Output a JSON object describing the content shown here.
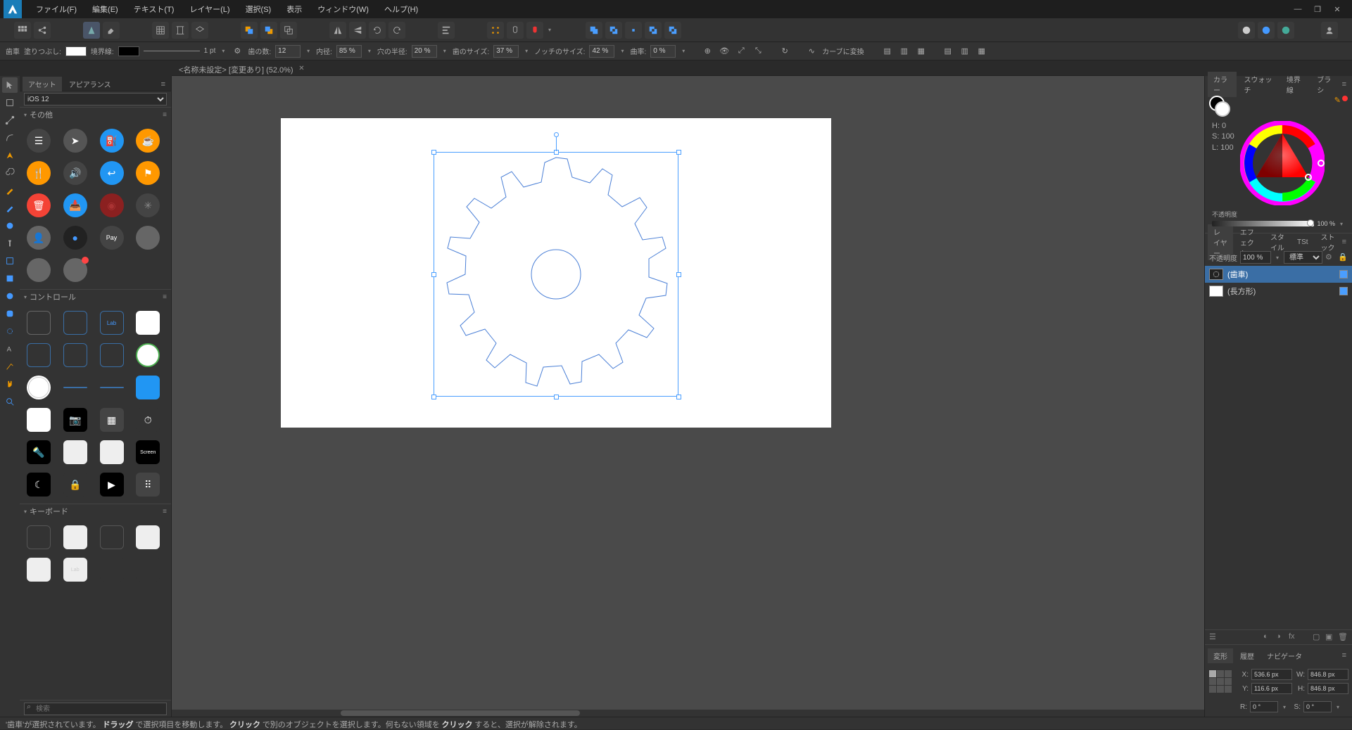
{
  "menu": {
    "items": [
      "ファイル(F)",
      "編集(E)",
      "テキスト(T)",
      "レイヤー(L)",
      "選択(S)",
      "表示",
      "ウィンドウ(W)",
      "ヘルプ(H)"
    ]
  },
  "document": {
    "title": "<名称未設定> [変更あり] (52.0%)"
  },
  "context": {
    "tool": "歯車",
    "fill_label": "塗りつぶし:",
    "stroke_label": "境界線:",
    "stroke_width": "1 pt",
    "teeth_label": "歯の数:",
    "teeth": "12",
    "inner_label": "内径:",
    "inner": "85 %",
    "hole_label": "穴の半径:",
    "hole": "20 %",
    "tooth_size_label": "歯のサイズ:",
    "tooth_size": "37 %",
    "notch_label": "ノッチのサイズ:",
    "notch": "42 %",
    "curve_label": "曲率:",
    "curve": "0 %",
    "convert": "カーブに変換"
  },
  "left": {
    "tabs": [
      "アセット",
      "アピアランス"
    ],
    "preset": "iOS 12",
    "sections": {
      "misc": "その他",
      "controls": "コントロール",
      "keyboard": "キーボード"
    },
    "search_ph": "検索"
  },
  "right": {
    "color_tabs": [
      "カラー",
      "スウォッチ",
      "境界線",
      "ブラシ"
    ],
    "hsl": {
      "h": "H: 0",
      "s": "S: 100",
      "l": "L: 100"
    },
    "opacity_label": "不透明度",
    "opacity_value": "100 %",
    "layer_tabs": [
      "レイヤー",
      "エフェクト",
      "スタイル",
      "TSt",
      "ストック"
    ],
    "layer_opacity_label": "不透明度",
    "layer_opacity": "100 %",
    "blend": "標準",
    "layers": [
      {
        "name": "(歯車)",
        "selected": true
      },
      {
        "name": "(長方形)",
        "selected": false
      }
    ],
    "nav_tabs": [
      "変形",
      "履歴",
      "ナビゲータ"
    ],
    "transform": {
      "x_label": "X:",
      "x": "536.6 px",
      "y_label": "Y:",
      "y": "116.6 px",
      "w_label": "W:",
      "w": "846.8 px",
      "h_label": "H:",
      "h": "846.8 px",
      "r_label": "R:",
      "r": "0 °",
      "s_label": "S:",
      "s": "0 °"
    }
  },
  "status": {
    "p1a": "'歯車'が選択されています。",
    "p1b": "ドラッグ",
    "p1c": "で選択項目を移動します。",
    "p2b": "クリック",
    "p2c": "で別のオブジェクトを選択します。何もない領域を",
    "p3b": "クリック",
    "p3c": "すると、選択が解除されます。"
  }
}
